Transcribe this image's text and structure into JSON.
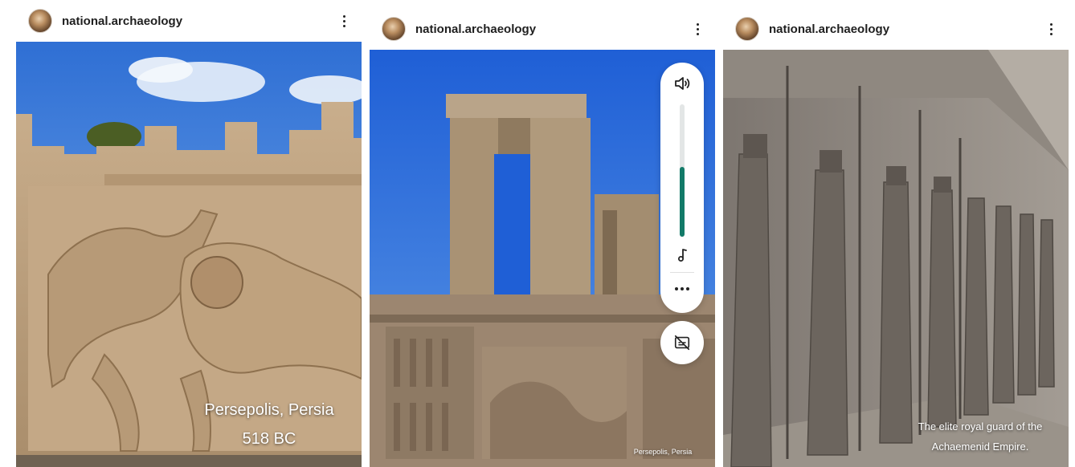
{
  "posts": [
    {
      "username": "national.archaeology",
      "avatar_icon": "avatar-photo",
      "more_icon": "more-vertical-icon",
      "caption_line1": "Persepolis, Persia",
      "caption_line2": "518 BC"
    },
    {
      "username": "national.archaeology",
      "avatar_icon": "avatar-photo",
      "more_icon": "more-vertical-icon",
      "caption": "Persepolis, Persia",
      "volume": {
        "speaker_icon": "volume-icon",
        "level": 0.53,
        "music_icon": "music-note-icon",
        "more_icon": "more-horizontal-icon",
        "accent_color": "#127a68"
      },
      "captions_off_icon": "captions-off-icon"
    },
    {
      "username": "national.archaeology",
      "avatar_icon": "avatar-photo",
      "more_icon": "more-vertical-icon",
      "caption_line1": "The elite royal guard of the",
      "caption_line2": "Achaemenid Empire."
    }
  ]
}
